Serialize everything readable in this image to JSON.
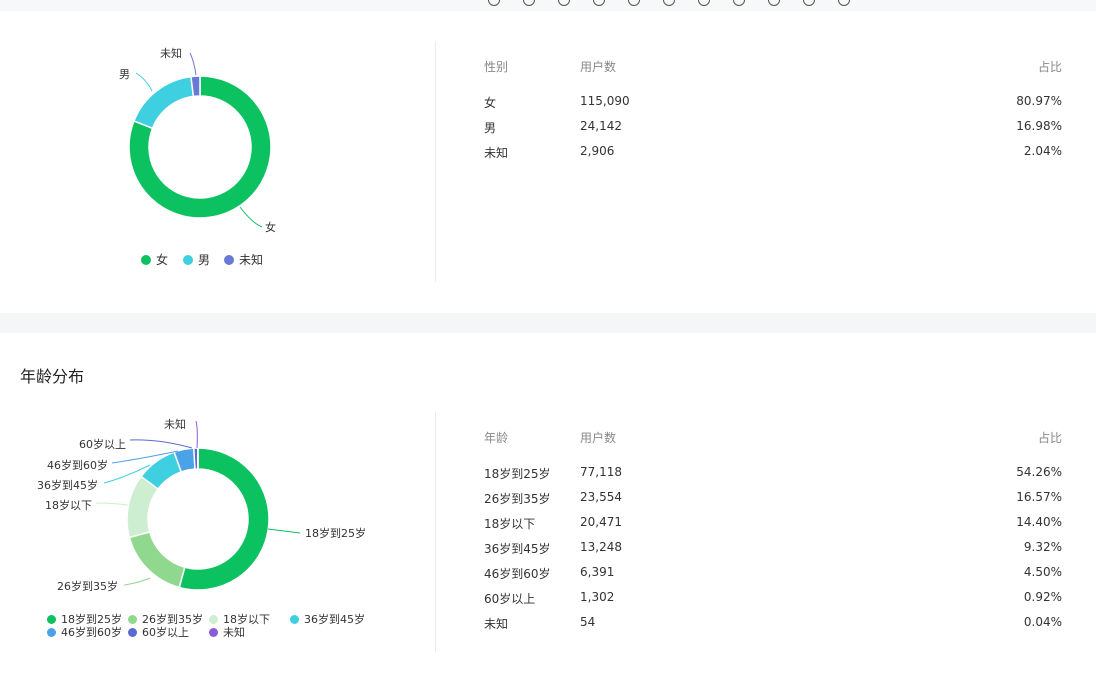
{
  "colors": {
    "female": "#0cc160",
    "male": "#3ecfe0",
    "unknown_gender": "#6a79d6",
    "age_18_25": "#0cc160",
    "age_26_35": "#8fd88e",
    "age_under18": "#cdeed0",
    "age_36_45": "#3ecfe0",
    "age_46_60": "#4aa3e8",
    "age_over60": "#5b6bd0",
    "age_unknown": "#8a5bd8"
  },
  "gender_section": {
    "table_headers": {
      "col1": "性别",
      "col2": "用户数",
      "col3": "占比"
    },
    "rows": [
      {
        "label": "女",
        "count": "115,090",
        "pct": "80.97%"
      },
      {
        "label": "男",
        "count": "24,142",
        "pct": "16.98%"
      },
      {
        "label": "未知",
        "count": "2,906",
        "pct": "2.04%"
      }
    ]
  },
  "age_section": {
    "title": "年龄分布",
    "table_headers": {
      "col1": "年龄",
      "col2": "用户数",
      "col3": "占比"
    },
    "rows": [
      {
        "label": "18岁到25岁",
        "count": "77,118",
        "pct": "54.26%"
      },
      {
        "label": "26岁到35岁",
        "count": "23,554",
        "pct": "16.57%"
      },
      {
        "label": "18岁以下",
        "count": "20,471",
        "pct": "14.40%"
      },
      {
        "label": "36岁到45岁",
        "count": "13,248",
        "pct": "9.32%"
      },
      {
        "label": "46岁到60岁",
        "count": "6,391",
        "pct": "4.50%"
      },
      {
        "label": "60岁以上",
        "count": "1,302",
        "pct": "0.92%"
      },
      {
        "label": "未知",
        "count": "54",
        "pct": "0.04%"
      }
    ]
  },
  "chart_data": [
    {
      "type": "pie",
      "donut": true,
      "categories": [
        "女",
        "男",
        "未知"
      ],
      "values": [
        115090,
        24142,
        2906
      ],
      "legend": [
        "女",
        "男",
        "未知"
      ],
      "legend_position": "bottom"
    },
    {
      "type": "pie",
      "donut": true,
      "categories": [
        "18岁到25岁",
        "26岁到35岁",
        "18岁以下",
        "36岁到45岁",
        "46岁到60岁",
        "60岁以上",
        "未知"
      ],
      "values": [
        77118,
        23554,
        20471,
        13248,
        6391,
        1302,
        54
      ],
      "legend": [
        "18岁到25岁",
        "26岁到35岁",
        "18岁以下",
        "36岁到45岁",
        "46岁到60岁",
        "60岁以上",
        "未知"
      ],
      "legend_position": "bottom"
    }
  ]
}
